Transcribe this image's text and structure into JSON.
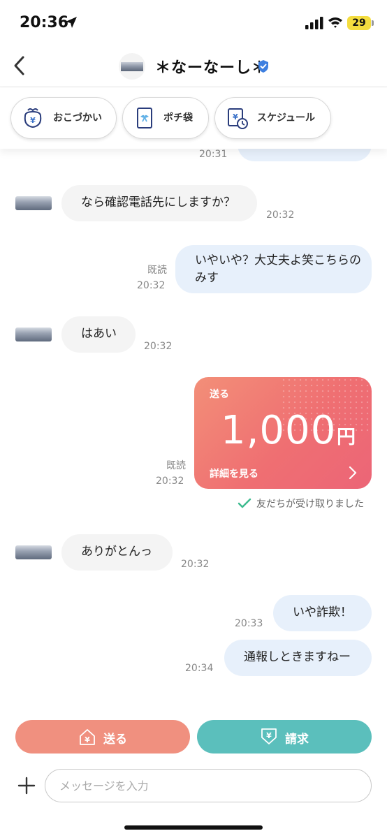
{
  "status_bar": {
    "time": "20:36",
    "battery": "29"
  },
  "header": {
    "title": "＊なーなーし＊"
  },
  "chips": [
    {
      "label": "おこづかい",
      "icon": "wallet-yen-icon"
    },
    {
      "label": "ポチ袋",
      "icon": "gift-envelope-icon"
    },
    {
      "label": "スケジュール",
      "icon": "schedule-yen-icon"
    }
  ],
  "messages": [
    {
      "side": "out",
      "text": "",
      "time": "20:31",
      "partial": true
    },
    {
      "side": "in",
      "text": "なら確認電話先にしますか？",
      "time": "20:32"
    },
    {
      "side": "out",
      "text": "いやいや？大丈夫よ笑こちらのみす",
      "time": "20:32",
      "read": "既読"
    },
    {
      "side": "in",
      "text": "はあい",
      "time": "20:32"
    },
    {
      "side": "in",
      "text": "ありがとんっ",
      "time": "20:32"
    },
    {
      "side": "out",
      "text": "いや詐欺！",
      "time": "20:33"
    },
    {
      "side": "out",
      "text": "通報しときますねー",
      "time": "20:34"
    }
  ],
  "money_card": {
    "label": "送る",
    "amount": "1,000",
    "unit": "円",
    "detail": "詳細を見る",
    "read": "既読",
    "time": "20:32",
    "received_text": "友だちが受け取りました"
  },
  "actions": {
    "send_label": "送る",
    "request_label": "請求",
    "send_color": "#f0907f",
    "request_color": "#5bbfbc"
  },
  "input": {
    "placeholder": "メッセージを入力"
  },
  "colors": {
    "out_bubble": "#e7f0fb",
    "in_bubble": "#f4f4f4",
    "check": "#3dbb8f"
  }
}
